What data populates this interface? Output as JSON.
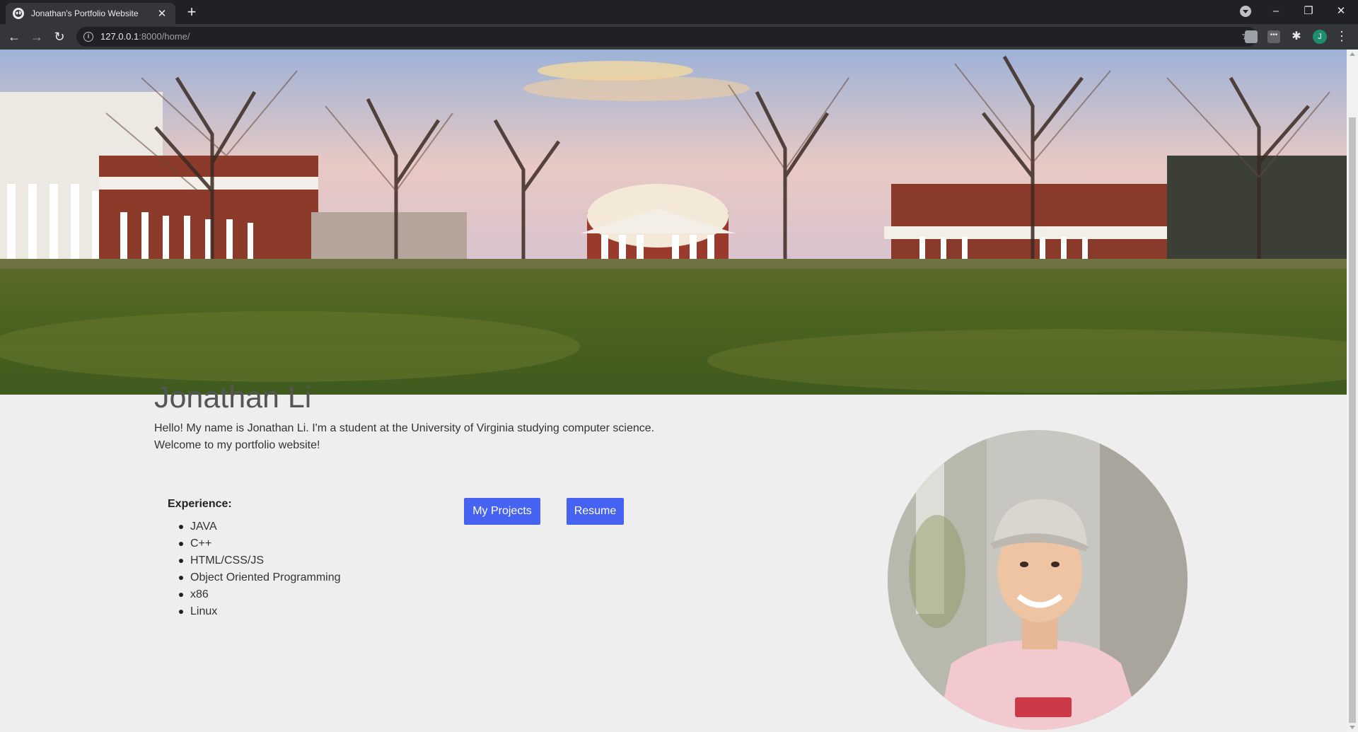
{
  "browser": {
    "tab_title": "Jonathan's Portfolio Website",
    "url_host": "127.0.0.1",
    "url_rest": ":8000/home/",
    "profile_initial": "J"
  },
  "hero": {
    "image": "campus-lawn-rotunda-photo"
  },
  "profile": {
    "name": "Jonathan Li",
    "intro_line1": "Hello! My name is Jonathan Li. I'm a student at the University of Virginia studying computer science.",
    "intro_line2": "Welcome to my portfolio website!",
    "photo": "profile-portrait-photo"
  },
  "experience": {
    "heading": "Experience:",
    "items": [
      "JAVA",
      "C++",
      "HTML/CSS/JS",
      "Object Oriented Programming",
      "x86",
      "Linux"
    ]
  },
  "buttons": {
    "projects": "My Projects",
    "resume": "Resume"
  },
  "colors": {
    "accent": "#4662f0",
    "background": "#eeeeee",
    "chrome_dark": "#202124",
    "chrome_mid": "#35363a"
  }
}
